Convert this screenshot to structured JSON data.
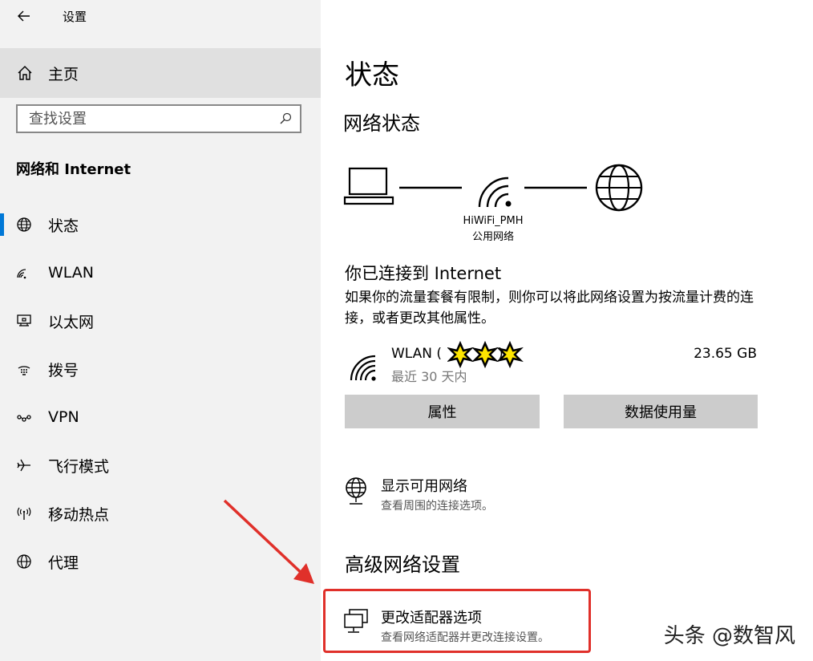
{
  "app": {
    "title": "设置"
  },
  "sidebar": {
    "home_label": "主页",
    "search_placeholder": "查找设置",
    "section_title": "网络和 Internet",
    "items": [
      {
        "label": "状态",
        "icon": "globe-status-icon",
        "active": true
      },
      {
        "label": "WLAN",
        "icon": "wifi-icon"
      },
      {
        "label": "以太网",
        "icon": "ethernet-icon"
      },
      {
        "label": "拨号",
        "icon": "dialup-icon"
      },
      {
        "label": "VPN",
        "icon": "vpn-icon"
      },
      {
        "label": "飞行模式",
        "icon": "airplane-icon"
      },
      {
        "label": "移动热点",
        "icon": "hotspot-icon"
      },
      {
        "label": "代理",
        "icon": "proxy-globe-icon"
      }
    ]
  },
  "main": {
    "title": "状态",
    "network_status_heading": "网络状态",
    "network": {
      "name": "HiWiFi_PMH",
      "type": "公用网络"
    },
    "connected_title": "你已连接到 Internet",
    "connected_desc": "如果你的流量套餐有限制，则你可以将此网络设置为按流量计费的连接，或者更改其他属性。",
    "wlan": {
      "name": "WLAN (",
      "name_end": ")",
      "period": "最近 30 天内",
      "usage": "23.65 GB"
    },
    "buttons": {
      "properties": "属性",
      "data_usage": "数据使用量"
    },
    "show_networks": {
      "title": "显示可用网络",
      "subtitle": "查看周围的连接选项。"
    },
    "advanced_heading": "高级网络设置",
    "adapter_options": {
      "title": "更改适配器选项",
      "subtitle": "查看网络适配器并更改连接设置。"
    }
  },
  "watermark": "头条 @数智风",
  "colors": {
    "accent": "#0078d7",
    "highlight": "#e0302a",
    "sidebar_bg": "#f2f2f2"
  }
}
